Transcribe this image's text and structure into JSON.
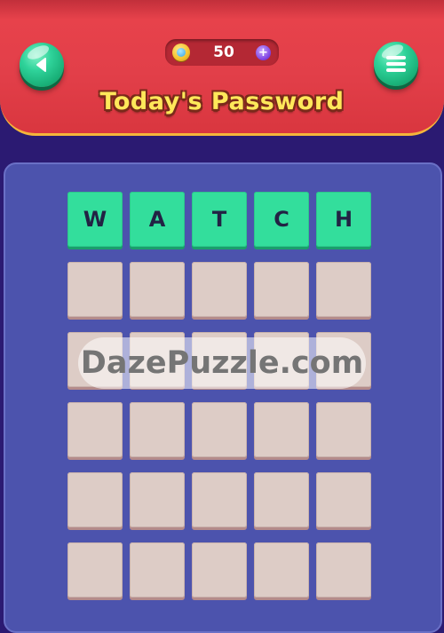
{
  "header": {
    "title": "Today's Password",
    "coins": "50",
    "add_coins_symbol": "+",
    "back_icon": "back-arrow-icon",
    "menu_icon": "hamburger-menu-icon"
  },
  "colors": {
    "header_bg": "#e23f49",
    "page_bg": "#2b1a72",
    "board_bg": "#4c53ad",
    "tile_filled": "#33de9c",
    "tile_empty": "#ddccc6",
    "title_text": "#ffe85a"
  },
  "board": {
    "rows": [
      [
        "W",
        "A",
        "T",
        "C",
        "H"
      ],
      [
        "",
        "",
        "",
        "",
        ""
      ],
      [
        "",
        "",
        "",
        "",
        ""
      ],
      [
        "",
        "",
        "",
        "",
        ""
      ],
      [
        "",
        "",
        "",
        "",
        ""
      ],
      [
        "",
        "",
        "",
        "",
        ""
      ]
    ]
  },
  "watermark": "DazePuzzle.com"
}
